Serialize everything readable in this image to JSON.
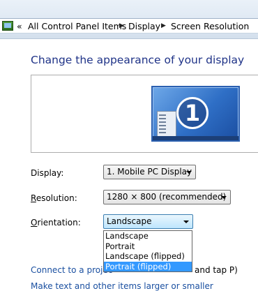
{
  "breadcrumb": {
    "back_glyph": "«",
    "items": [
      "All Control Panel Items",
      "Display",
      "Screen Resolution"
    ]
  },
  "heading": "Change the appearance of your display",
  "monitor": {
    "number": "1"
  },
  "display": {
    "label": "Display:",
    "value": "1. Mobile PC Display"
  },
  "resolution": {
    "label_first": "R",
    "label_rest": "esolution:",
    "value": "1280 × 800 (recommended)"
  },
  "orientation": {
    "label_first": "O",
    "label_rest": "rientation:",
    "value": "Landscape",
    "options": [
      "Landscape",
      "Portrait",
      "Landscape (flipped)",
      "Portrait (flipped)"
    ],
    "highlighted": "Portrait (flipped)"
  },
  "links": {
    "projector": "Connect to a projec",
    "projector_tail": "and tap P)",
    "text_size": "Make text and other items larger or smaller"
  },
  "colors": {
    "heading": "#1e3287",
    "link": "#1a4fa0",
    "highlight": "#3399ff"
  }
}
